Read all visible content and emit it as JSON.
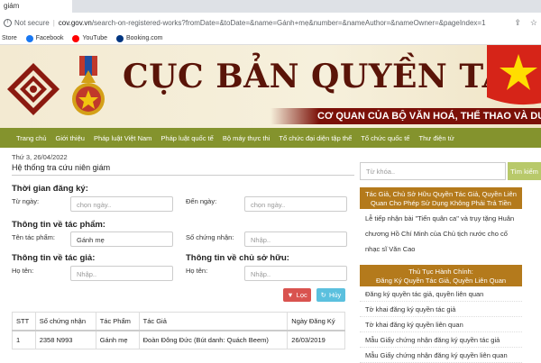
{
  "browser": {
    "tab_title": "giám",
    "not_secure": "Not secure",
    "url_host": "cov.gov.vn",
    "url_path": "/search-on-registered-works?fromDate=&toDate=&name=Gánh+mẹ&number=&nameAuthor=&nameOwner=&pageIndex=1",
    "bookmarks": [
      {
        "label": "Store",
        "icon": "store-icon",
        "color": "#777777"
      },
      {
        "label": "Facebook",
        "icon": "facebook-icon",
        "color": "#1877f2"
      },
      {
        "label": "YouTube",
        "icon": "youtube-icon",
        "color": "#ff0000"
      },
      {
        "label": "Booking.com",
        "icon": "booking-icon",
        "color": "#003580"
      }
    ]
  },
  "banner": {
    "title": "CỤC BẢN QUYỀN TÁC GIẢ",
    "subtitle": "CƠ QUAN CỦA BỘ VĂN HOÁ, THỂ THAO VÀ DU LỊC"
  },
  "nav": {
    "items": [
      "Trang chủ",
      "Giới thiệu",
      "Pháp luật Việt Nam",
      "Pháp luật quốc tế",
      "Bộ máy thực thi",
      "Tổ chức đại diện tập thể",
      "Tổ chức quốc tế",
      "Thư điện tử"
    ]
  },
  "main": {
    "date": "Thứ 3, 26/04/2022",
    "title": "Hệ thống tra cứu niên giám",
    "reg_time": {
      "heading": "Thời gian đăng ký:",
      "from_label": "Từ ngày:",
      "from_placeholder": "chọn ngày..",
      "to_label": "Đến ngày:",
      "to_placeholder": "chọn ngày.."
    },
    "work": {
      "heading": "Thông tin về tác phẩm:",
      "name_label": "Tên tác phẩm:",
      "name_value": "Gánh mẹ",
      "cert_label": "Số chứng nhận:",
      "cert_placeholder": "Nhập.."
    },
    "author": {
      "heading": "Thông tin về tác giả:",
      "name_label": "Họ tên:",
      "name_placeholder": "Nhập.."
    },
    "owner": {
      "heading": "Thông tin về chủ sở hữu:",
      "name_label": "Họ tên:",
      "name_placeholder": "Nhập.."
    },
    "buttons": {
      "filter": "Lọc",
      "cancel": "Hủy"
    },
    "table": {
      "headers": [
        "STT",
        "Số chứng nhận",
        "Tác Phẩm",
        "Tác Giả",
        "Ngày Đăng Ký"
      ],
      "rows": [
        [
          "1",
          "2358 N993",
          "Gánh mẹ",
          "Đoàn Đông Đức (Bút danh: Quách Beem)",
          "26/03/2019"
        ]
      ]
    }
  },
  "sidebar": {
    "search_placeholder": "Từ khóa..",
    "search_button": "Tìm kiếm",
    "box1_title": "Tác Giả, Chủ Sở Hữu Quyền Tác Giả, Quyền Liên Quan Cho Phép Sử Dụng Không Phải Trả Tiền",
    "box1_text": "Lễ tiếp nhận bài \"Tiến quân ca\" và trụy tặng Huân chương Hồ Chí Minh của Chủ tịch nước cho cố nhạc sĩ Văn Cao",
    "box2_title_line1": "Thủ Tục Hành Chính:",
    "box2_title_line2": "Đăng Ký Quyền Tác Giả, Quyền Liên Quan",
    "box2_links": [
      "Đăng ký quyền tác giả, quyền liên quan",
      "Tờ khai đăng ký quyền tác giả",
      "Tờ khai đăng ký quyền liên quan",
      "Mẫu Giấy chứng nhận đăng ký quyền tác giả",
      "Mẫu Giấy chứng nhận đăng ký quyền liên quan"
    ]
  }
}
